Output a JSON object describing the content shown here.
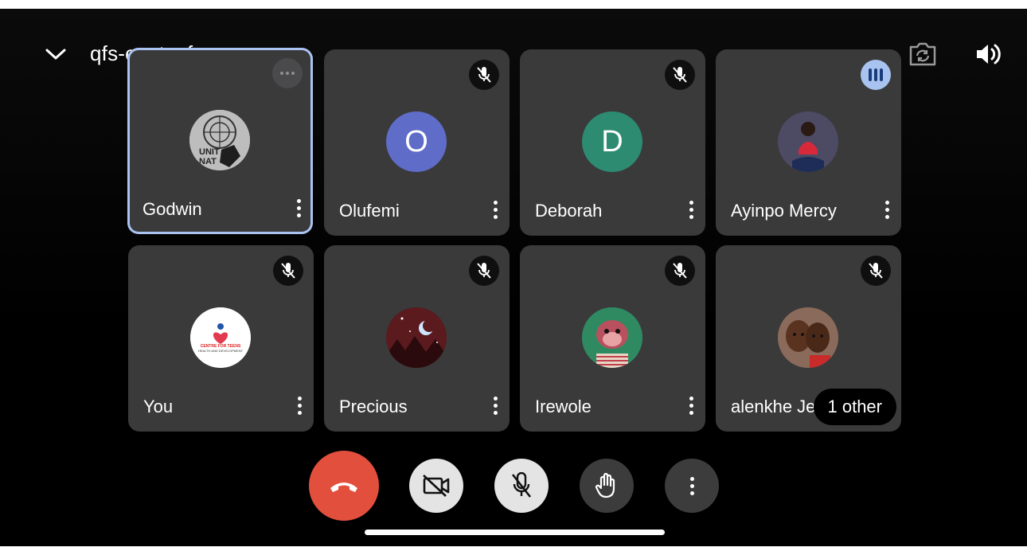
{
  "meeting": {
    "code": "qfs-eqct-wfn"
  },
  "colors": {
    "end_call": "#e34f3d",
    "active_border": "#aac3f2",
    "tile_bg": "#3a3a3b",
    "avatar_o": "#5f6cc8",
    "avatar_d": "#2d8b72"
  },
  "participants": [
    {
      "name": "Godwin",
      "avatar": "photo",
      "status": "more-icon",
      "active": true
    },
    {
      "name": "Olufemi",
      "avatar_letter": "O",
      "status": "mic-off-icon"
    },
    {
      "name": "Deborah",
      "avatar_letter": "D",
      "status": "mic-off-icon"
    },
    {
      "name": "Ayinpo Mercy",
      "avatar": "photo",
      "status": "speaking-icon"
    },
    {
      "name": "You",
      "avatar": "logo",
      "status": "mic-off-icon"
    },
    {
      "name": "Precious",
      "avatar": "photo",
      "status": "mic-off-icon"
    },
    {
      "name": "Irewole",
      "avatar": "photo",
      "status": "mic-off-icon"
    },
    {
      "name": "alenkhe Je",
      "avatar": "photo",
      "status": "mic-off-icon"
    }
  ],
  "overflow": {
    "label": "1 other"
  },
  "you_avatar_text": {
    "line1": "CENTRE FOR TEENS",
    "line2": "HEALTH AND DEVELOPMENT"
  },
  "godwin_avatar_text": {
    "line1": "UNIT",
    "line2": "NAT"
  },
  "controls": [
    "end-call-icon",
    "camera-off-icon",
    "mic-off-icon",
    "raise-hand-icon",
    "more-options-icon"
  ]
}
